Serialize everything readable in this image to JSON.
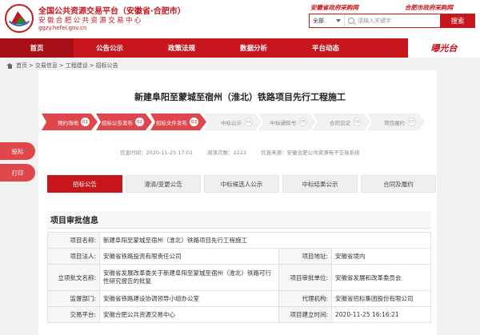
{
  "header": {
    "title": "全国公共资源交易平台（安徽省·合肥市）",
    "subtitle": "安徽合肥公共资源交易中心",
    "url": "ggzy.hefei.gov.cn",
    "motto_left": "安徽省政府采购网",
    "motto_right": "合肥市政府采购网",
    "search": {
      "scope": "全部",
      "placeholder": "请输入关键字",
      "button": "搜索"
    }
  },
  "nav": {
    "items": [
      "首页",
      "公告公示",
      "政策法规",
      "数据分析",
      "平台动态"
    ],
    "brand": "曝光台"
  },
  "breadcrumb": [
    "首页",
    "交易信息",
    "工程建设",
    "招标公告"
  ],
  "title": "新建阜阳至蒙城至宿州（淮北）铁路项目先行工程施工",
  "steps": [
    {
      "label": "预约场地",
      "num": "01",
      "done": true
    },
    {
      "label": "招标公告发布",
      "num": "02",
      "done": true
    },
    {
      "label": "招标文件发布",
      "num": "03",
      "done": true
    },
    {
      "label": "中标公示",
      "num": "04",
      "done": false
    },
    {
      "label": "中标通知书",
      "num": "05",
      "done": false
    },
    {
      "label": "合同见证",
      "num": "06",
      "done": false
    },
    {
      "label": "项目履约",
      "num": "07",
      "done": false
    }
  ],
  "info_bar": {
    "time_label": "信息时间：",
    "time": "2020-11-25 17:01",
    "views_label": "阅读次数：",
    "views": "2222",
    "source_label": "信息来源：",
    "source": "安徽合肥公共资源电子交易系统"
  },
  "side_buttons": [
    "投标",
    "打印"
  ],
  "tabs": [
    "招标公告",
    "澄清/变更公告",
    "中标候选人公示",
    "中标结果公示",
    "合同及履约"
  ],
  "section_title": "项目审批信息",
  "table": {
    "project_name_label": "项目名称:",
    "project_name": "新建阜阳至蒙城至宿州（淮北）铁路项目先行工程施工",
    "legal_label": "项目法人:",
    "legal": "安徽省铁路投资有限责任公司",
    "location_label": "项目地址:",
    "location": "安徽省境内",
    "approval_doc_label": "立项批文名称:",
    "approval_doc": "安徽省发展改革委关于新建阜阳至蒙城至宿州（淮北）铁路可行性研究报告的批复",
    "approval_dept_label": "项目审批单位:",
    "approval_dept": "安徽省发展和改革委员会",
    "supervisor_label": "监督部门:",
    "supervisor": "安徽省铁路建设协调领导小组办公室",
    "agent_label": "代理机构:",
    "agent": "安徽省招标集团股份有限公司",
    "platform_label": "交易平台:",
    "platform": "安徽合肥公共资源交易中心",
    "created_label": "项目建立时间:",
    "created": "2020-11-25 16:16:21"
  },
  "colors": {
    "brand_red": "#c8161d",
    "step_done": "#e0474d",
    "step_todo": "#f2f2f2"
  }
}
